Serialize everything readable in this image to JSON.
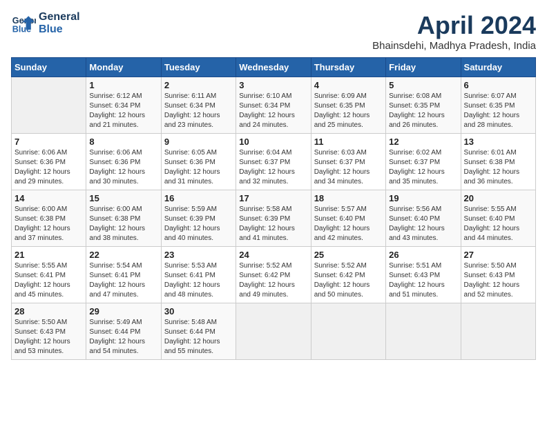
{
  "header": {
    "logo_line1": "General",
    "logo_line2": "Blue",
    "title": "April 2024",
    "subtitle": "Bhainsdehi, Madhya Pradesh, India"
  },
  "weekdays": [
    "Sunday",
    "Monday",
    "Tuesday",
    "Wednesday",
    "Thursday",
    "Friday",
    "Saturday"
  ],
  "weeks": [
    [
      {
        "day": "",
        "info": ""
      },
      {
        "day": "1",
        "info": "Sunrise: 6:12 AM\nSunset: 6:34 PM\nDaylight: 12 hours\nand 21 minutes."
      },
      {
        "day": "2",
        "info": "Sunrise: 6:11 AM\nSunset: 6:34 PM\nDaylight: 12 hours\nand 23 minutes."
      },
      {
        "day": "3",
        "info": "Sunrise: 6:10 AM\nSunset: 6:34 PM\nDaylight: 12 hours\nand 24 minutes."
      },
      {
        "day": "4",
        "info": "Sunrise: 6:09 AM\nSunset: 6:35 PM\nDaylight: 12 hours\nand 25 minutes."
      },
      {
        "day": "5",
        "info": "Sunrise: 6:08 AM\nSunset: 6:35 PM\nDaylight: 12 hours\nand 26 minutes."
      },
      {
        "day": "6",
        "info": "Sunrise: 6:07 AM\nSunset: 6:35 PM\nDaylight: 12 hours\nand 28 minutes."
      }
    ],
    [
      {
        "day": "7",
        "info": "Sunrise: 6:06 AM\nSunset: 6:36 PM\nDaylight: 12 hours\nand 29 minutes."
      },
      {
        "day": "8",
        "info": "Sunrise: 6:06 AM\nSunset: 6:36 PM\nDaylight: 12 hours\nand 30 minutes."
      },
      {
        "day": "9",
        "info": "Sunrise: 6:05 AM\nSunset: 6:36 PM\nDaylight: 12 hours\nand 31 minutes."
      },
      {
        "day": "10",
        "info": "Sunrise: 6:04 AM\nSunset: 6:37 PM\nDaylight: 12 hours\nand 32 minutes."
      },
      {
        "day": "11",
        "info": "Sunrise: 6:03 AM\nSunset: 6:37 PM\nDaylight: 12 hours\nand 34 minutes."
      },
      {
        "day": "12",
        "info": "Sunrise: 6:02 AM\nSunset: 6:37 PM\nDaylight: 12 hours\nand 35 minutes."
      },
      {
        "day": "13",
        "info": "Sunrise: 6:01 AM\nSunset: 6:38 PM\nDaylight: 12 hours\nand 36 minutes."
      }
    ],
    [
      {
        "day": "14",
        "info": "Sunrise: 6:00 AM\nSunset: 6:38 PM\nDaylight: 12 hours\nand 37 minutes."
      },
      {
        "day": "15",
        "info": "Sunrise: 6:00 AM\nSunset: 6:38 PM\nDaylight: 12 hours\nand 38 minutes."
      },
      {
        "day": "16",
        "info": "Sunrise: 5:59 AM\nSunset: 6:39 PM\nDaylight: 12 hours\nand 40 minutes."
      },
      {
        "day": "17",
        "info": "Sunrise: 5:58 AM\nSunset: 6:39 PM\nDaylight: 12 hours\nand 41 minutes."
      },
      {
        "day": "18",
        "info": "Sunrise: 5:57 AM\nSunset: 6:40 PM\nDaylight: 12 hours\nand 42 minutes."
      },
      {
        "day": "19",
        "info": "Sunrise: 5:56 AM\nSunset: 6:40 PM\nDaylight: 12 hours\nand 43 minutes."
      },
      {
        "day": "20",
        "info": "Sunrise: 5:55 AM\nSunset: 6:40 PM\nDaylight: 12 hours\nand 44 minutes."
      }
    ],
    [
      {
        "day": "21",
        "info": "Sunrise: 5:55 AM\nSunset: 6:41 PM\nDaylight: 12 hours\nand 45 minutes."
      },
      {
        "day": "22",
        "info": "Sunrise: 5:54 AM\nSunset: 6:41 PM\nDaylight: 12 hours\nand 47 minutes."
      },
      {
        "day": "23",
        "info": "Sunrise: 5:53 AM\nSunset: 6:41 PM\nDaylight: 12 hours\nand 48 minutes."
      },
      {
        "day": "24",
        "info": "Sunrise: 5:52 AM\nSunset: 6:42 PM\nDaylight: 12 hours\nand 49 minutes."
      },
      {
        "day": "25",
        "info": "Sunrise: 5:52 AM\nSunset: 6:42 PM\nDaylight: 12 hours\nand 50 minutes."
      },
      {
        "day": "26",
        "info": "Sunrise: 5:51 AM\nSunset: 6:43 PM\nDaylight: 12 hours\nand 51 minutes."
      },
      {
        "day": "27",
        "info": "Sunrise: 5:50 AM\nSunset: 6:43 PM\nDaylight: 12 hours\nand 52 minutes."
      }
    ],
    [
      {
        "day": "28",
        "info": "Sunrise: 5:50 AM\nSunset: 6:43 PM\nDaylight: 12 hours\nand 53 minutes."
      },
      {
        "day": "29",
        "info": "Sunrise: 5:49 AM\nSunset: 6:44 PM\nDaylight: 12 hours\nand 54 minutes."
      },
      {
        "day": "30",
        "info": "Sunrise: 5:48 AM\nSunset: 6:44 PM\nDaylight: 12 hours\nand 55 minutes."
      },
      {
        "day": "",
        "info": ""
      },
      {
        "day": "",
        "info": ""
      },
      {
        "day": "",
        "info": ""
      },
      {
        "day": "",
        "info": ""
      }
    ]
  ]
}
